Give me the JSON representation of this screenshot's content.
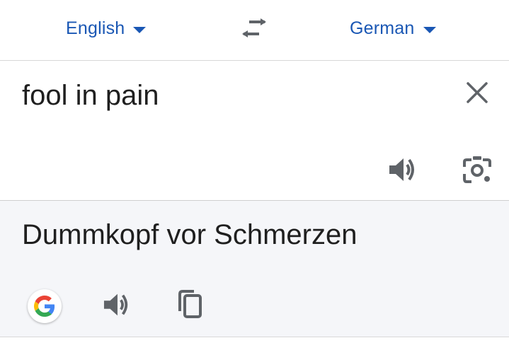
{
  "languages": {
    "source": "English",
    "target": "German"
  },
  "source": {
    "text": "fool in pain"
  },
  "translation": {
    "text": "Dummkopf vor Schmerzen"
  },
  "icons": {
    "source_dropdown": "caret-down-icon",
    "target_dropdown": "caret-down-icon",
    "swap": "swap-arrows-icon",
    "clear": "close-icon",
    "source_speak": "speaker-icon",
    "camera": "google-lens-icon",
    "google": "google-g-icon",
    "target_speak": "speaker-icon",
    "copy": "copy-icon"
  },
  "colors": {
    "accent": "#1a57b4",
    "text": "#1f1f1f",
    "icon": "#5f6368",
    "translation_bg": "#f5f6f9"
  }
}
